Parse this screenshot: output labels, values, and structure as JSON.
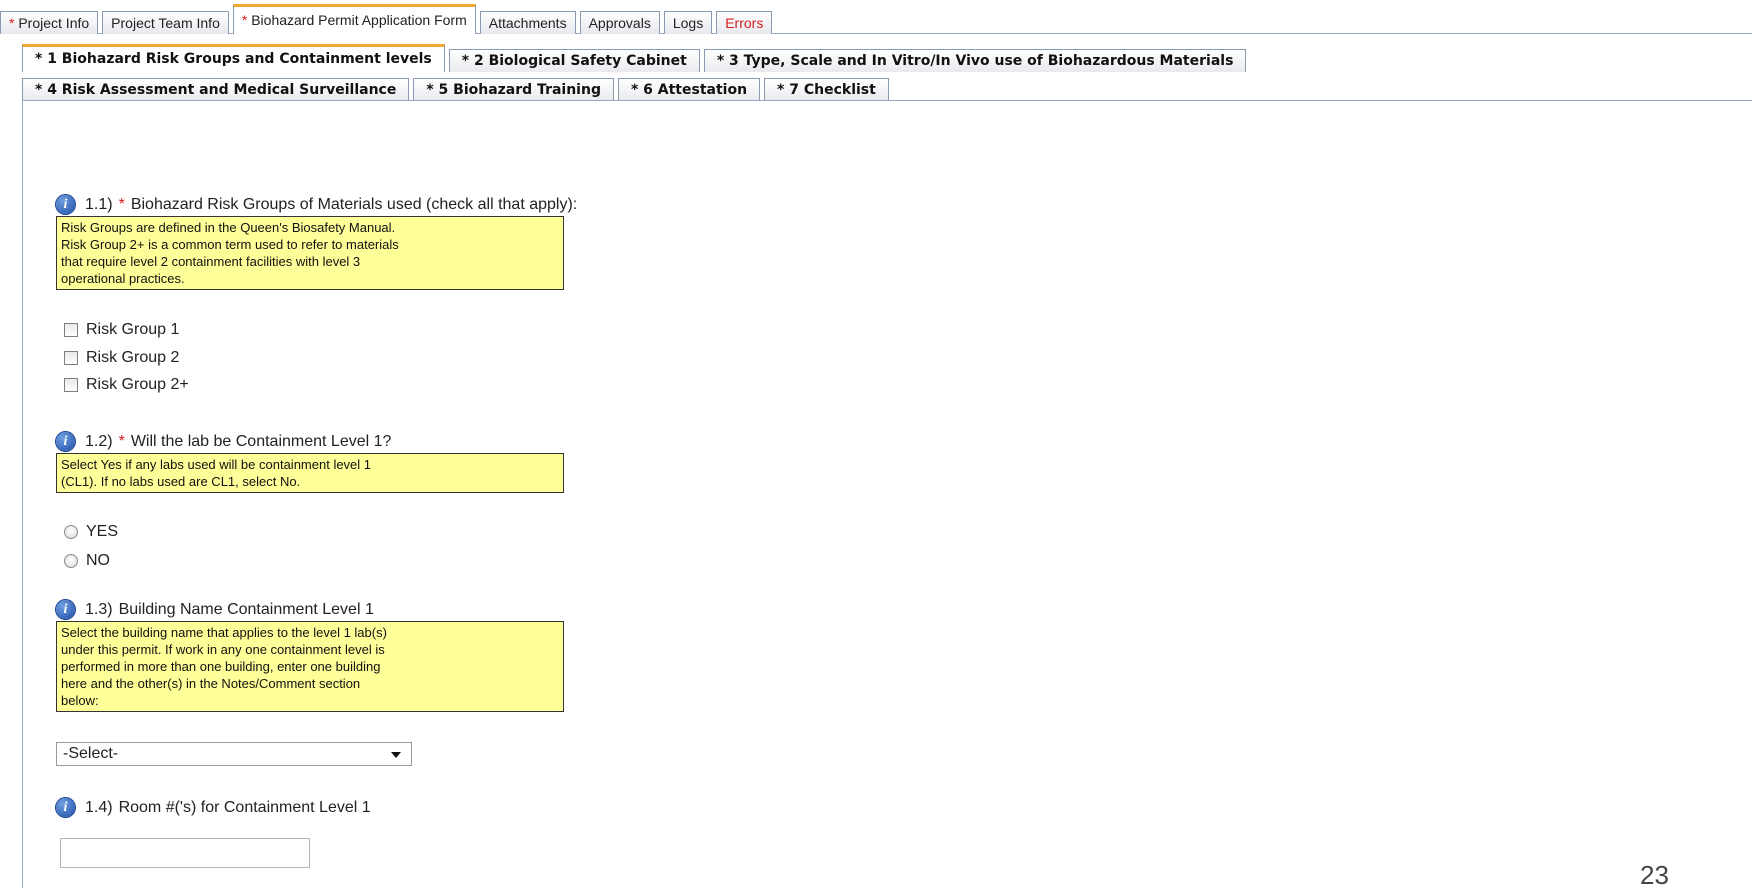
{
  "top_tabs": [
    {
      "required": true,
      "label": "Project Info"
    },
    {
      "required": false,
      "label": "Project Team Info"
    },
    {
      "required": true,
      "label": "Biohazard Permit Application Form"
    },
    {
      "required": false,
      "label": "Attachments"
    },
    {
      "required": false,
      "label": "Approvals"
    },
    {
      "required": false,
      "label": "Logs"
    },
    {
      "required": false,
      "label": "Errors"
    }
  ],
  "sub_tabs_row1": [
    "* 1 Biohazard Risk Groups and Containment levels",
    "* 2 Biological Safety Cabinet",
    "* 3 Type, Scale and In Vitro/In Vivo use of Biohazardous Materials"
  ],
  "sub_tabs_row2": [
    "* 4 Risk Assessment and Medical Surveillance",
    "* 5 Biohazard Training",
    "* 6 Attestation",
    "* 7 Checklist"
  ],
  "questions": {
    "q1": {
      "number": "1.1)",
      "required_mark": "*",
      "label": "Biohazard Risk Groups of Materials used (check all that apply):",
      "note_lines": [
        "Risk Groups are defined in the Queen's Biosafety Manual.",
        "Risk Group 2+ is a common term used to refer to materials",
        "that require level 2 containment facilities with level 3",
        "operational practices."
      ],
      "options": [
        "Risk Group 1",
        "Risk Group 2",
        "Risk Group 2+"
      ]
    },
    "q2": {
      "number": "1.2)",
      "required_mark": "*",
      "label": "Will the lab be Containment Level 1?",
      "note_lines": [
        "Select Yes if any labs used will be containment level 1",
        "(CL1). If no labs used are CL1, select No."
      ],
      "options": [
        "YES",
        "NO"
      ]
    },
    "q3": {
      "number": "1.3)",
      "label": "Building Name Containment Level 1",
      "note_lines": [
        "Select the building name that applies to the level 1 lab(s)",
        "under this permit. If work in any one containment level is",
        "performed in more than one building, enter one building",
        "here and the other(s) in the Notes/Comment section",
        "below:"
      ],
      "select_value": "-Select-"
    },
    "q4": {
      "number": "1.4)",
      "label": "Room #('s) for Containment Level 1",
      "input_value": ""
    }
  },
  "page_number": "23"
}
